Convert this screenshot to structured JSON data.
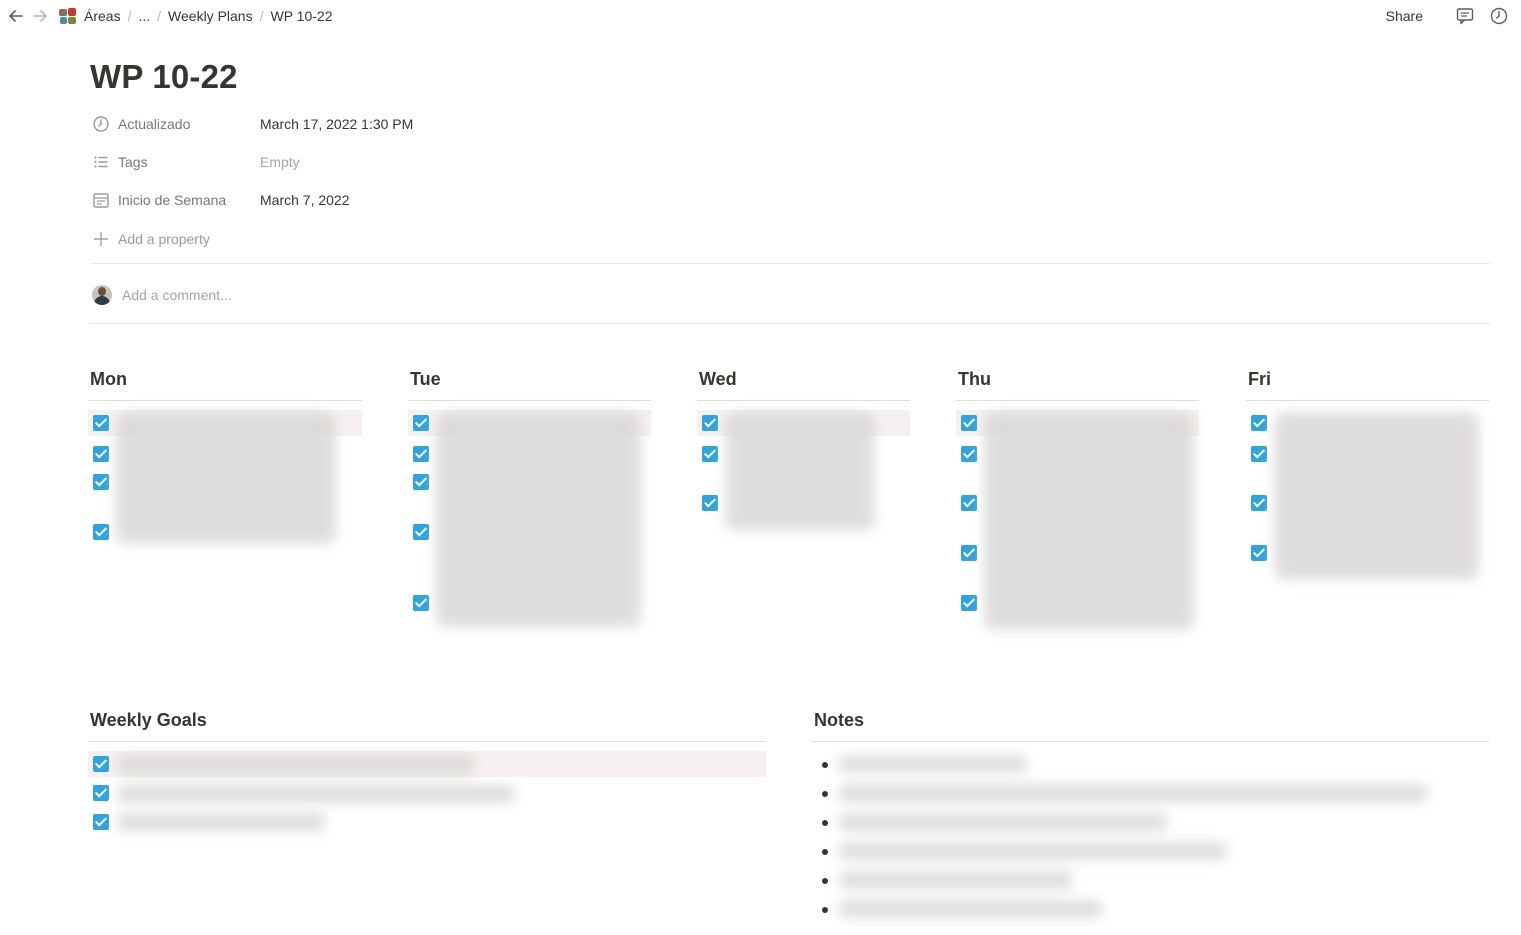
{
  "topbar": {
    "back_icon": "arrow-left-icon",
    "forward_icon": "arrow-right-icon",
    "breadcrumbs": [
      "Áreas",
      "...",
      "Weekly Plans",
      "WP 10-22"
    ],
    "separator": "/",
    "share_label": "Share",
    "comments_icon": "comment-icon",
    "updates_icon": "clock-icon"
  },
  "page": {
    "title": "WP 10-22",
    "properties": [
      {
        "name": "Actualizado",
        "value": "March 17, 2022 1:30 PM",
        "icon": "clock-icon"
      },
      {
        "name": "Tags",
        "value": "Empty",
        "icon": "list-icon"
      },
      {
        "name": "Inicio de Semana",
        "value": "March 7, 2022",
        "icon": "calendar-icon"
      }
    ],
    "add_property_label": "Add a property",
    "comment_placeholder": "Add a comment..."
  },
  "days": [
    {
      "label": "Mon",
      "items": 4
    },
    {
      "label": "Tue",
      "items": 5
    },
    {
      "label": "Wed",
      "items": 3
    },
    {
      "label": "Thu",
      "items": 5
    },
    {
      "label": "Fri",
      "items": 4
    }
  ],
  "weekly_goals": {
    "label": "Weekly Goals",
    "items": 3
  },
  "notes": {
    "label": "Notes",
    "items": 6
  },
  "colors": {
    "checkbox": "#2ea4e0",
    "highlight": "#f6f1f0",
    "text": "#37352f",
    "muted": "#787774"
  }
}
